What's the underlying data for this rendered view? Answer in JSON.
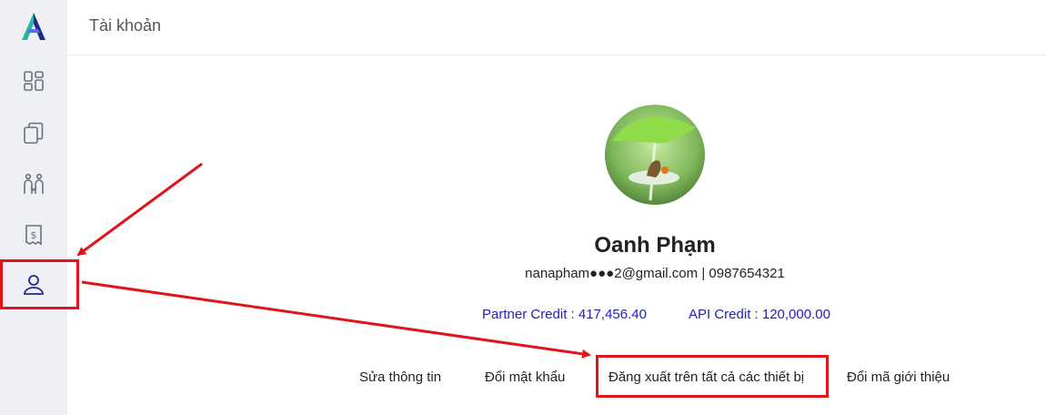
{
  "header": {
    "title": "Tài khoản"
  },
  "sidebar": {
    "items": [
      {
        "icon": "dashboard-icon"
      },
      {
        "icon": "documents-icon"
      },
      {
        "icon": "partners-icon"
      },
      {
        "icon": "billing-icon"
      },
      {
        "icon": "user-icon",
        "active": true
      }
    ]
  },
  "profile": {
    "name": "Oanh Phạm",
    "email": "nanapham●●●2@gmail.com",
    "separator": "|",
    "phone": "0987654321",
    "partner_credit": "Partner Credit : 417,456.40",
    "api_credit": "API Credit : 120,000.00"
  },
  "actions": {
    "edit": "Sửa thông tin",
    "change_password": "Đổi mật khẩu",
    "logout_all": "Đăng xuất trên tất cả các thiết bị",
    "change_referral": "Đổi mã giới thiệu"
  },
  "colors": {
    "annotation": "#e0141b",
    "active_icon": "#1f2a8c",
    "credit_text": "#2222bb"
  }
}
